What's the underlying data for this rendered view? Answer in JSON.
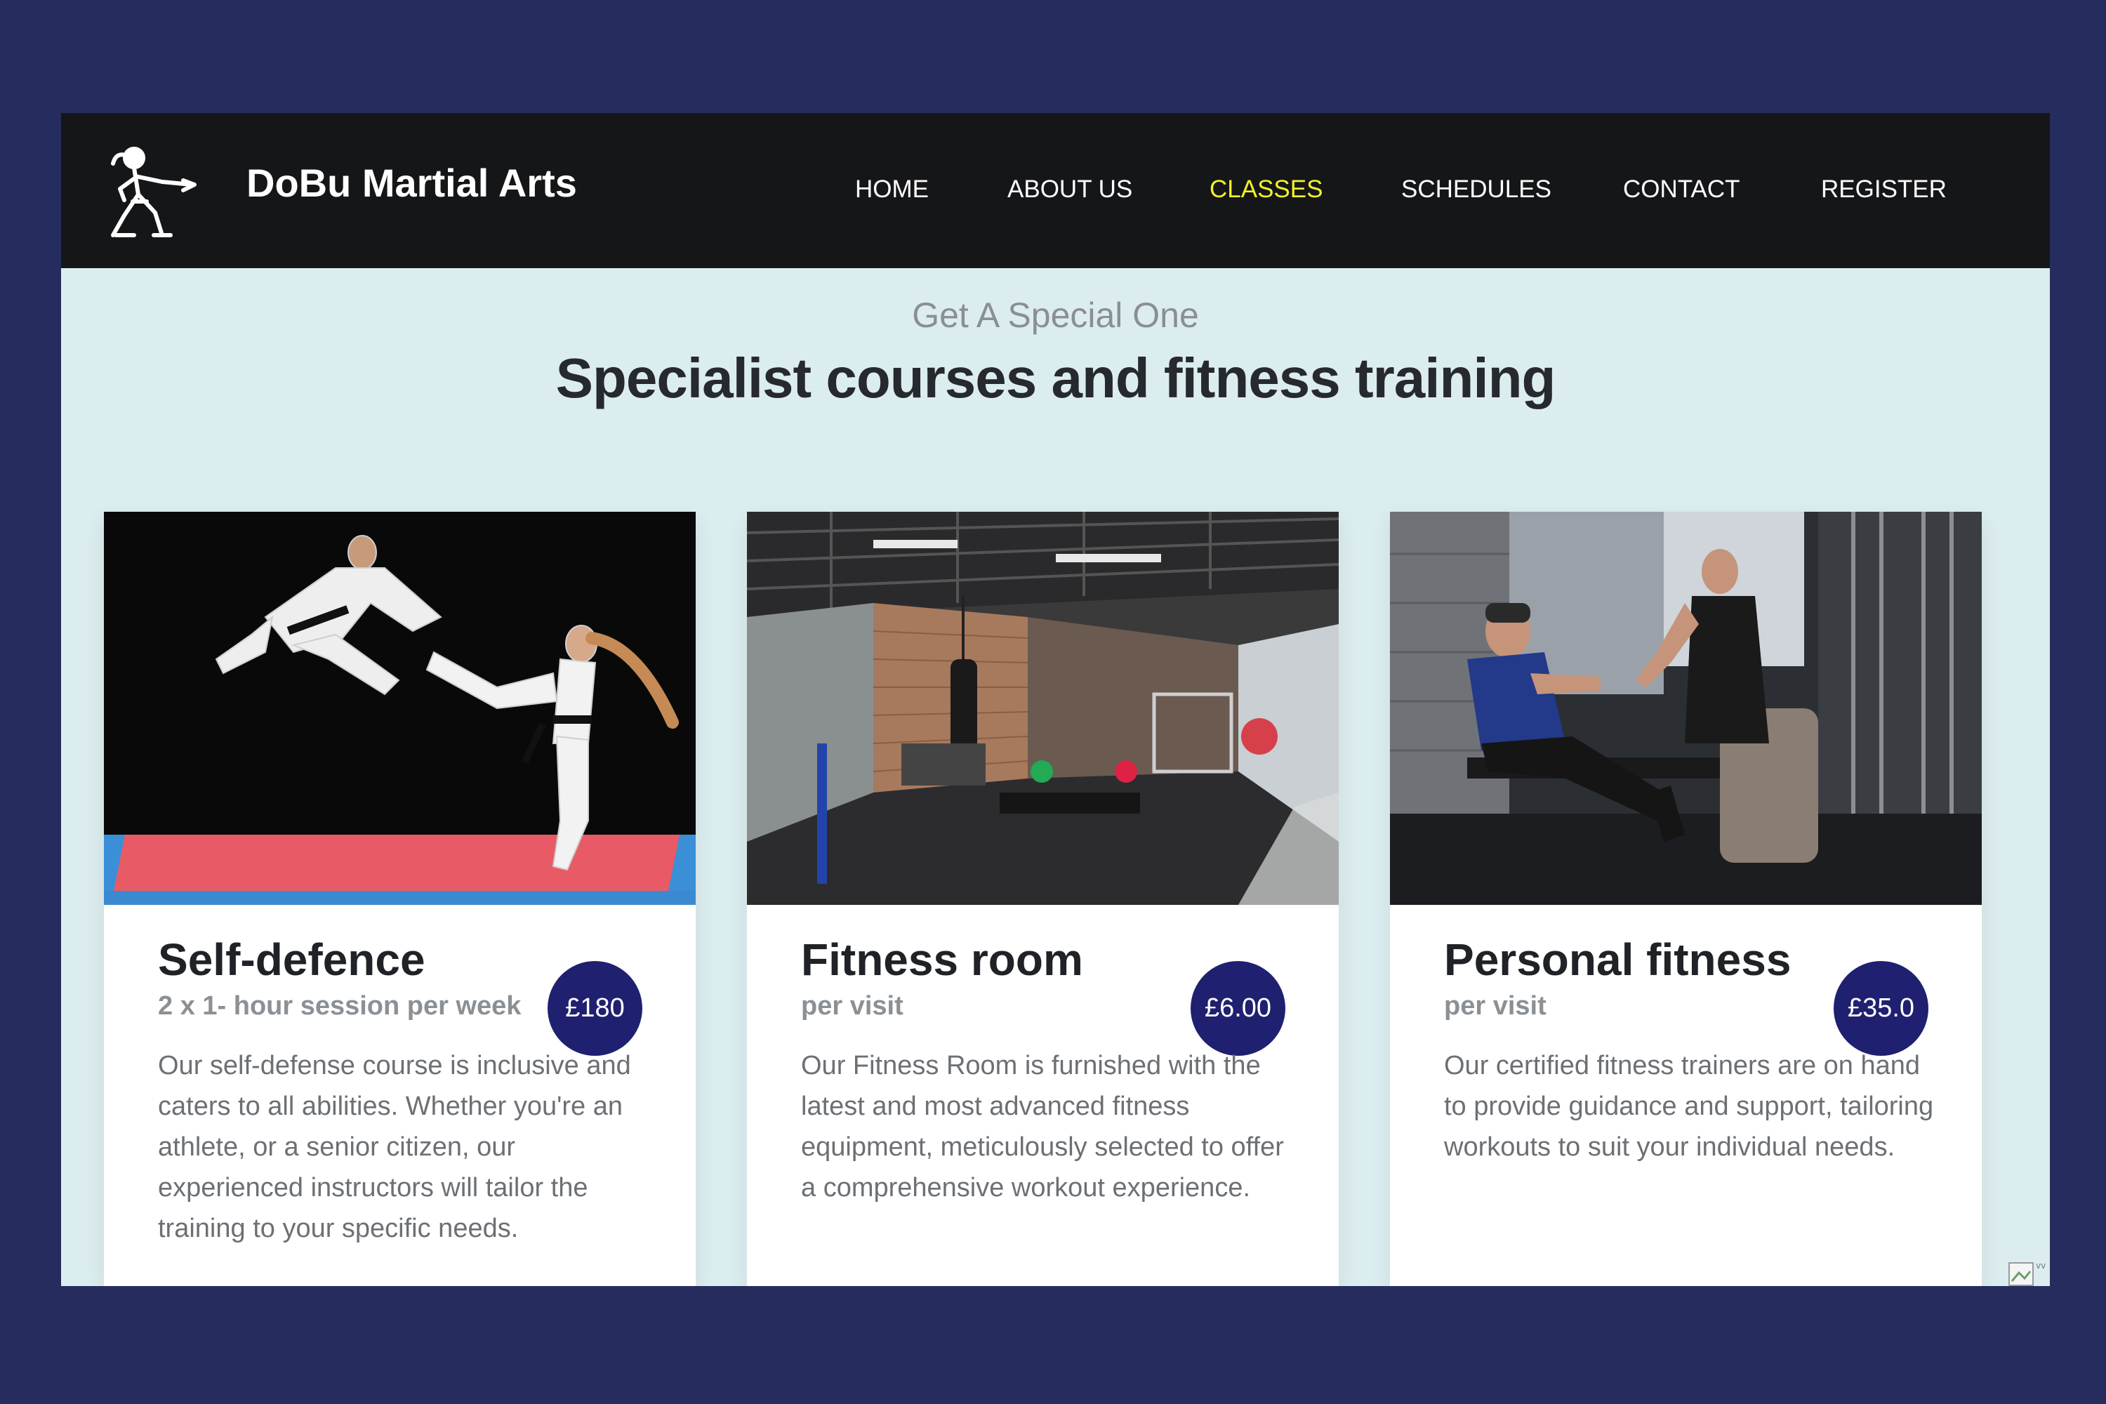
{
  "brand": {
    "name": "DoBu Martial Arts",
    "logo_icon": "martial-artist-kick-icon"
  },
  "nav": {
    "items": [
      {
        "label": "HOME",
        "active": false
      },
      {
        "label": "ABOUT US",
        "active": false
      },
      {
        "label": "CLASSES",
        "active": true
      },
      {
        "label": "SCHEDULES",
        "active": false
      },
      {
        "label": "CONTACT",
        "active": false
      },
      {
        "label": "REGISTER",
        "active": false
      }
    ],
    "active_color": "#f1f12a"
  },
  "hero": {
    "kicker": "Get A Special One",
    "headline": "Specialist courses and fitness training"
  },
  "cards": [
    {
      "title": "Self-defence",
      "subtitle": "2 x 1- hour session per week",
      "price": "£180",
      "image": "two martial artists kicking on red mat",
      "description": "Our self-defense course is inclusive and caters to all abilities. Whether you're an athlete, or a senior citizen, our experienced instructors will tailor the training to your specific needs."
    },
    {
      "title": "Fitness room",
      "subtitle": "per visit",
      "price": "£6.00",
      "image": "gym room with brick walls and equipment",
      "description": "Our Fitness Room is furnished with the latest and most advanced fitness equipment, meticulously selected to offer a comprehensive workout experience."
    },
    {
      "title": "Personal fitness",
      "subtitle": "per visit",
      "price": "£35.0",
      "image": "trainer guiding man on rowing machine",
      "description": "Our certified fitness trainers are on hand to provide guidance and support, tailoring workouts to suit your individual needs."
    }
  ],
  "colors": {
    "page_background": "#262d5e",
    "navbar": "#151618",
    "section_background": "#dcedf0",
    "price_badge": "#1f2070"
  }
}
